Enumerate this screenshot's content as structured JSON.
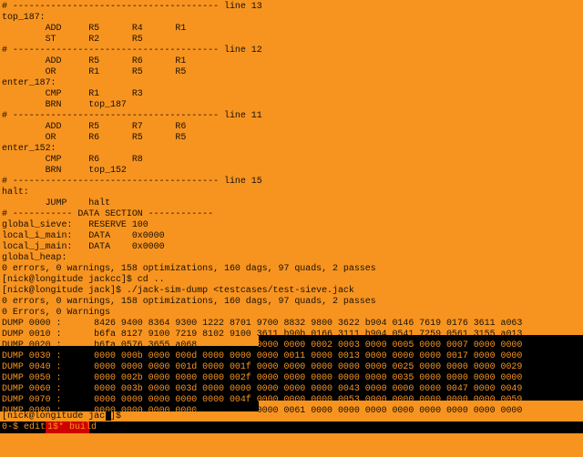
{
  "terminal": {
    "lines": [
      "# -------------------------------------- line 13",
      "top_187:",
      "        ADD     R5      R4      R1",
      "        ST      R2      R5",
      "# -------------------------------------- line 12",
      "        ADD     R5      R6      R1",
      "        OR      R1      R5      R5",
      "enter_187:",
      "        CMP     R1      R3",
      "        BRN     top_187",
      "# -------------------------------------- line 11",
      "        ADD     R5      R7      R6",
      "        OR      R6      R5      R5",
      "enter_152:",
      "        CMP     R6      R8",
      "        BRN     top_152",
      "# -------------------------------------- line 15",
      "halt:",
      "        JUMP    halt",
      "# ----------- DATA SECTION ------------",
      "global_sieve:   RESERVE 100",
      "local_i_main:   DATA    0x0000",
      "local_j_main:   DATA    0x0000",
      "global_heap:",
      "0 errors, 0 warnings, 158 optimizations, 160 dags, 97 quads, 2 passes",
      "[nick@longitude jackcc]$ cd ..",
      "[nick@longitude jack]$ ./jack-sim-dump <testcases/test-sieve.jack",
      "0 errors, 0 warnings, 158 optimizations, 160 dags, 97 quads, 2 passes",
      "0 Errors, 0 Warnings"
    ],
    "dump_lines": [
      "DUMP 0000 :      8426 9400 8364 9300 1222 8701 9700 8832 9800 3622 b904 0146 7619 0176 3611 a063",
      "DUMP 0010 :      b6fa 8127 9100 7219 8102 9100 3611 b90b 0166 3111 b904 0541 7259 0561 3155 a013",
      "DUMP 0020 :      b6fa 0576 3655 a068 b6f3 b9ff 0000 0000 0002 0003 0000 0005 0000 0007 0000 0000",
      "DUMP 0030 :      0000 000b 0000 000d 0000 0000 0000 0011 0000 0013 0000 0000 0000 0017 0000 0000",
      "DUMP 0040 :      0000 0000 0000 001d 0000 001f 0000 0000 0000 0000 0000 0025 0000 0000 0000 0029",
      "DUMP 0050 :      0000 002b 0000 0000 0000 002f 0000 0000 0000 0000 0000 0035 0000 0000 0000 0000",
      "DUMP 0060 :      0000 003b 0000 003d 0000 0000 0000 0000 0000 0043 0000 0000 0000 0047 0000 0049",
      "DUMP 0070 :      0000 0000 0000 0000 0000 004f 0000 0000 0000 0053 0000 0000 0000 0000 0000 0059",
      "DUMP 0080 :      0000 0000 0000 0000 0000 0000 0000 0061 0000 0000 0000 0000 0000 0000 0000 0000"
    ],
    "prompt": "[nick@longitude jack]$ "
  },
  "status_bar": {
    "left": "0-$ edit",
    "window_label": "1$* build"
  },
  "colors": {
    "background": "#f79420",
    "foreground": "#1a1000",
    "selection": "#000000",
    "status_active": "#d00000"
  }
}
